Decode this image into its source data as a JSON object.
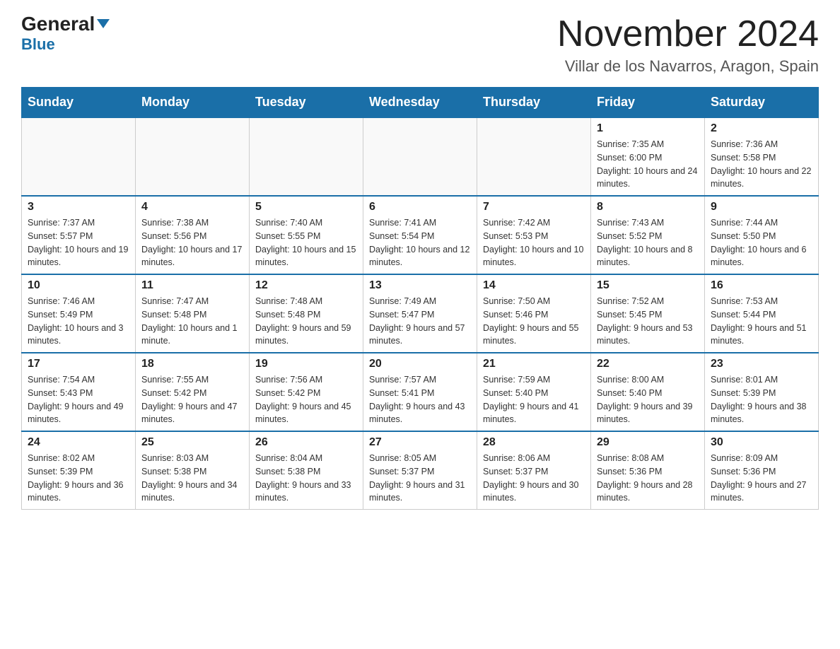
{
  "logo": {
    "text_general": "General",
    "triangle": "▲",
    "text_blue": "Blue"
  },
  "header": {
    "month_year": "November 2024",
    "location": "Villar de los Navarros, Aragon, Spain"
  },
  "weekdays": [
    "Sunday",
    "Monday",
    "Tuesday",
    "Wednesday",
    "Thursday",
    "Friday",
    "Saturday"
  ],
  "weeks": [
    [
      {
        "day": "",
        "info": ""
      },
      {
        "day": "",
        "info": ""
      },
      {
        "day": "",
        "info": ""
      },
      {
        "day": "",
        "info": ""
      },
      {
        "day": "",
        "info": ""
      },
      {
        "day": "1",
        "info": "Sunrise: 7:35 AM\nSunset: 6:00 PM\nDaylight: 10 hours and 24 minutes."
      },
      {
        "day": "2",
        "info": "Sunrise: 7:36 AM\nSunset: 5:58 PM\nDaylight: 10 hours and 22 minutes."
      }
    ],
    [
      {
        "day": "3",
        "info": "Sunrise: 7:37 AM\nSunset: 5:57 PM\nDaylight: 10 hours and 19 minutes."
      },
      {
        "day": "4",
        "info": "Sunrise: 7:38 AM\nSunset: 5:56 PM\nDaylight: 10 hours and 17 minutes."
      },
      {
        "day": "5",
        "info": "Sunrise: 7:40 AM\nSunset: 5:55 PM\nDaylight: 10 hours and 15 minutes."
      },
      {
        "day": "6",
        "info": "Sunrise: 7:41 AM\nSunset: 5:54 PM\nDaylight: 10 hours and 12 minutes."
      },
      {
        "day": "7",
        "info": "Sunrise: 7:42 AM\nSunset: 5:53 PM\nDaylight: 10 hours and 10 minutes."
      },
      {
        "day": "8",
        "info": "Sunrise: 7:43 AM\nSunset: 5:52 PM\nDaylight: 10 hours and 8 minutes."
      },
      {
        "day": "9",
        "info": "Sunrise: 7:44 AM\nSunset: 5:50 PM\nDaylight: 10 hours and 6 minutes."
      }
    ],
    [
      {
        "day": "10",
        "info": "Sunrise: 7:46 AM\nSunset: 5:49 PM\nDaylight: 10 hours and 3 minutes."
      },
      {
        "day": "11",
        "info": "Sunrise: 7:47 AM\nSunset: 5:48 PM\nDaylight: 10 hours and 1 minute."
      },
      {
        "day": "12",
        "info": "Sunrise: 7:48 AM\nSunset: 5:48 PM\nDaylight: 9 hours and 59 minutes."
      },
      {
        "day": "13",
        "info": "Sunrise: 7:49 AM\nSunset: 5:47 PM\nDaylight: 9 hours and 57 minutes."
      },
      {
        "day": "14",
        "info": "Sunrise: 7:50 AM\nSunset: 5:46 PM\nDaylight: 9 hours and 55 minutes."
      },
      {
        "day": "15",
        "info": "Sunrise: 7:52 AM\nSunset: 5:45 PM\nDaylight: 9 hours and 53 minutes."
      },
      {
        "day": "16",
        "info": "Sunrise: 7:53 AM\nSunset: 5:44 PM\nDaylight: 9 hours and 51 minutes."
      }
    ],
    [
      {
        "day": "17",
        "info": "Sunrise: 7:54 AM\nSunset: 5:43 PM\nDaylight: 9 hours and 49 minutes."
      },
      {
        "day": "18",
        "info": "Sunrise: 7:55 AM\nSunset: 5:42 PM\nDaylight: 9 hours and 47 minutes."
      },
      {
        "day": "19",
        "info": "Sunrise: 7:56 AM\nSunset: 5:42 PM\nDaylight: 9 hours and 45 minutes."
      },
      {
        "day": "20",
        "info": "Sunrise: 7:57 AM\nSunset: 5:41 PM\nDaylight: 9 hours and 43 minutes."
      },
      {
        "day": "21",
        "info": "Sunrise: 7:59 AM\nSunset: 5:40 PM\nDaylight: 9 hours and 41 minutes."
      },
      {
        "day": "22",
        "info": "Sunrise: 8:00 AM\nSunset: 5:40 PM\nDaylight: 9 hours and 39 minutes."
      },
      {
        "day": "23",
        "info": "Sunrise: 8:01 AM\nSunset: 5:39 PM\nDaylight: 9 hours and 38 minutes."
      }
    ],
    [
      {
        "day": "24",
        "info": "Sunrise: 8:02 AM\nSunset: 5:39 PM\nDaylight: 9 hours and 36 minutes."
      },
      {
        "day": "25",
        "info": "Sunrise: 8:03 AM\nSunset: 5:38 PM\nDaylight: 9 hours and 34 minutes."
      },
      {
        "day": "26",
        "info": "Sunrise: 8:04 AM\nSunset: 5:38 PM\nDaylight: 9 hours and 33 minutes."
      },
      {
        "day": "27",
        "info": "Sunrise: 8:05 AM\nSunset: 5:37 PM\nDaylight: 9 hours and 31 minutes."
      },
      {
        "day": "28",
        "info": "Sunrise: 8:06 AM\nSunset: 5:37 PM\nDaylight: 9 hours and 30 minutes."
      },
      {
        "day": "29",
        "info": "Sunrise: 8:08 AM\nSunset: 5:36 PM\nDaylight: 9 hours and 28 minutes."
      },
      {
        "day": "30",
        "info": "Sunrise: 8:09 AM\nSunset: 5:36 PM\nDaylight: 9 hours and 27 minutes."
      }
    ]
  ]
}
